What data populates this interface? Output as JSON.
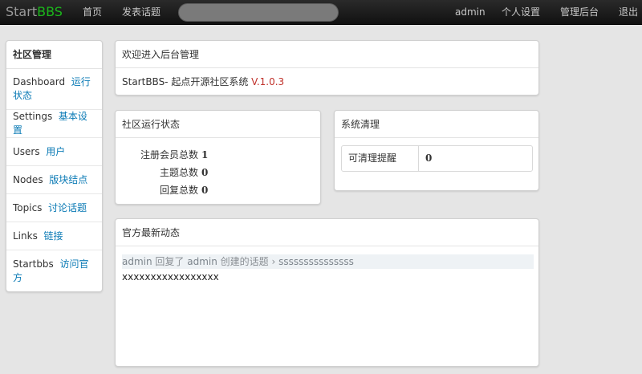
{
  "navbar": {
    "brand_start": "Start",
    "brand_bbs": "BBS",
    "links": {
      "home": "首页",
      "post": "发表话题",
      "user": "admin",
      "settings": "个人设置",
      "admin": "管理后台",
      "logout": "退出"
    },
    "search_value": ""
  },
  "sidebar": {
    "title": "社区管理",
    "items": [
      {
        "en": "Dashboard",
        "cn": "运行状态"
      },
      {
        "en": "Settings",
        "cn": "基本设置"
      },
      {
        "en": "Users",
        "cn": "用户"
      },
      {
        "en": "Nodes",
        "cn": "版块结点"
      },
      {
        "en": "Topics",
        "cn": "讨论话题"
      },
      {
        "en": "Links",
        "cn": "链接"
      },
      {
        "en": "Startbbs",
        "cn": "访问官方"
      }
    ]
  },
  "welcome": {
    "title": "欢迎进入后台管理",
    "text": "StartBBS- 起点开源社区系统 ",
    "version": "V.1.0.3"
  },
  "status": {
    "title": "社区运行状态",
    "rows": [
      {
        "label": "注册会员总数",
        "value": "1"
      },
      {
        "label": "主题总数",
        "value": "0"
      },
      {
        "label": "回复总数",
        "value": "0"
      }
    ]
  },
  "cleanup": {
    "title": "系统清理",
    "label": "可清理提醒",
    "value": "0"
  },
  "news": {
    "title": "官方最新动态",
    "user1": "admin",
    "replied": " 回复了 ",
    "user2": "admin",
    "created": " 创建的话题 › ",
    "topic": "sssssssssssssss",
    "content": "xxxxxxxxxxxxxxxxx"
  },
  "colors": {
    "brand_accent": "#1bb51b",
    "link": "#0a7ab5",
    "version": "#c0302a"
  }
}
